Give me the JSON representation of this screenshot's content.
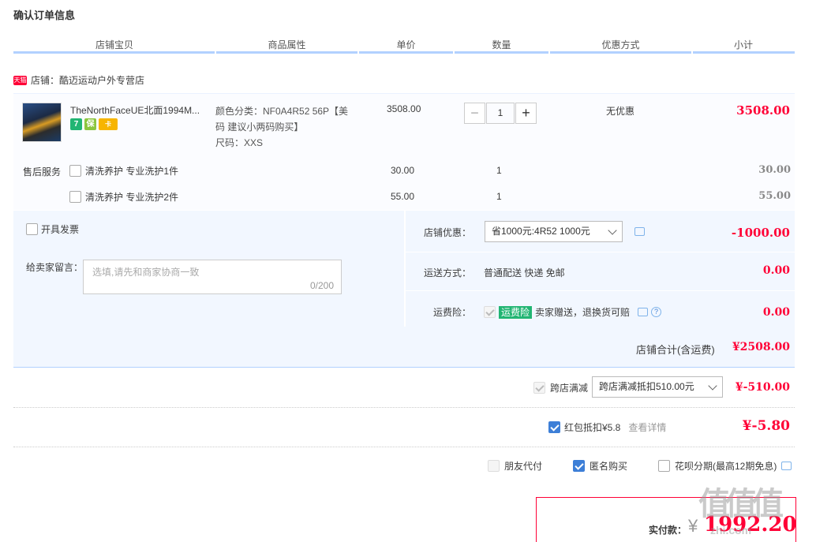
{
  "page": {
    "title": "确认订单信息"
  },
  "columns": [
    "店铺宝贝",
    "商品属性",
    "单价",
    "数量",
    "优惠方式",
    "小计"
  ],
  "shop": {
    "badge": "天猫",
    "label": "店铺：",
    "name": "酷迈运动户外专营店"
  },
  "item": {
    "name": "TheNorthFaceUE北面1994M...",
    "badges": [
      "7",
      "保",
      "卡"
    ],
    "attr_line1": "颜色分类：NF0A4R52 56P【美",
    "attr_line2": "码 建议小两码购买】",
    "attr_line3": "尺码：XXS",
    "unit_price": "3508.00",
    "qty": "1",
    "discount": "无优惠",
    "subtotal": "3508.00"
  },
  "services": {
    "label": "售后服务",
    "items": [
      {
        "name": "清洗养护 专业洗护1件",
        "price": "30.00",
        "qty": "1",
        "subtotal": "30.00"
      },
      {
        "name": "清洗养护 专业洗护2件",
        "price": "55.00",
        "qty": "1",
        "subtotal": "55.00"
      }
    ]
  },
  "invoice": {
    "label": "开具发票"
  },
  "message": {
    "label": "给卖家留言：",
    "placeholder": "选填,请先和商家协商一致",
    "counter": "0/200"
  },
  "shop_discount": {
    "label": "店铺优惠：",
    "selected": "省1000元:4R52 1000元",
    "amount": "-1000.00"
  },
  "shipping": {
    "label": "运送方式：",
    "value": "普通配送 快递 免邮",
    "amount": "0.00"
  },
  "freight_insurance": {
    "label": "运费险：",
    "tag": "运费险",
    "text": "卖家赠送，退换货可赔",
    "amount": "0.00"
  },
  "shop_total": {
    "label": "店铺合计(含运费)",
    "amount": "¥2508.00"
  },
  "cross_store": {
    "label": "跨店满减",
    "selected": "跨店满减抵扣510.00元",
    "amount": "¥-510.00"
  },
  "red_packet": {
    "label": "红包抵扣¥5.8",
    "link": "查看详情",
    "amount": "¥-5.80"
  },
  "options": {
    "friend_pay": "朋友代付",
    "anonymous": "匿名购买",
    "huabei": "花呗分期(最高12期免息)"
  },
  "payment": {
    "label": "实付款：",
    "currency": "¥",
    "amount": "1992.20"
  },
  "watermark": {
    "text": "值 什么值得买",
    "url": "zhi.com"
  },
  "colors": {
    "accent_red": "#ff0036",
    "accent_blue": "#3d7fd7",
    "panel_blue": "#f2f7ff",
    "header_line": "#b2d1ff"
  }
}
